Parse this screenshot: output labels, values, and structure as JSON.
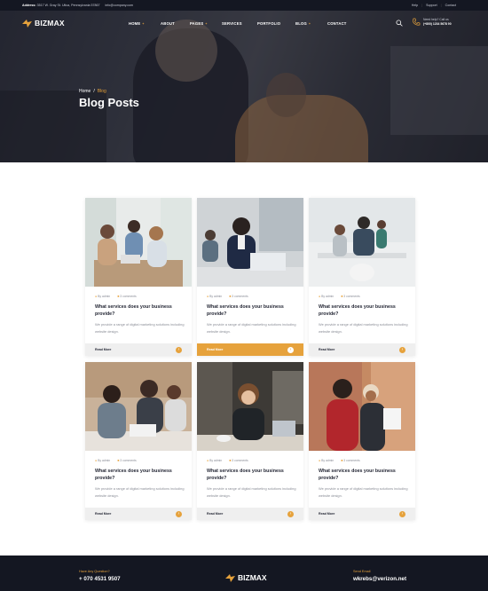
{
  "topbar": {
    "address_label": "Address:",
    "address_value": "3517 W. Gray St. Utica, Pennsylvania 57867",
    "email": "info@company.com",
    "links": [
      "Help",
      "Support",
      "Contact"
    ]
  },
  "brand": {
    "name": "BIZMAX",
    "accent": "#e6a23c",
    "dark": "#141722"
  },
  "nav": {
    "items": [
      {
        "label": "HOME",
        "has_caret": true,
        "caret": "+"
      },
      {
        "label": "ABOUT",
        "has_caret": false,
        "caret": ""
      },
      {
        "label": "PAGES",
        "has_caret": true,
        "caret": "+"
      },
      {
        "label": "SERVICES",
        "has_caret": false,
        "caret": ""
      },
      {
        "label": "PORTFOLIO",
        "has_caret": false,
        "caret": ""
      },
      {
        "label": "BLOG",
        "has_caret": true,
        "caret": "+"
      },
      {
        "label": "CONTACT",
        "has_caret": false,
        "caret": ""
      }
    ],
    "phone_label": "Need help? Call us",
    "phone_number": "(+800) 1234 5678 90"
  },
  "hero": {
    "breadcrumb_home": "Home",
    "breadcrumb_sep": "/",
    "breadcrumb_current": "Blog",
    "title": "Blog Posts"
  },
  "posts": [
    {
      "author": "By admin",
      "comments": "3 comments",
      "title": "What services does your business provide?",
      "excerpt": "We provide a range of digital marketing solutions including website design.",
      "more": "Read More",
      "active": false
    },
    {
      "author": "By admin",
      "comments": "3 comments",
      "title": "What services does your business provide?",
      "excerpt": "We provide a range of digital marketing solutions including website design.",
      "more": "Read More",
      "active": true
    },
    {
      "author": "By admin",
      "comments": "3 comments",
      "title": "What services does your business provide?",
      "excerpt": "We provide a range of digital marketing solutions including website design.",
      "more": "Read More",
      "active": false
    },
    {
      "author": "By admin",
      "comments": "3 comments",
      "title": "What services does your business provide?",
      "excerpt": "We provide a range of digital marketing solutions including website design.",
      "more": "Read More",
      "active": false
    },
    {
      "author": "By admin",
      "comments": "3 comments",
      "title": "What services does your business provide?",
      "excerpt": "We provide a range of digital marketing solutions including website design.",
      "more": "Read More",
      "active": false
    },
    {
      "author": "By admin",
      "comments": "3 comments",
      "title": "What services does your business provide?",
      "excerpt": "We provide a range of digital marketing solutions including website design.",
      "more": "Read More",
      "active": false
    }
  ],
  "footer": {
    "question_label": "Have Any Question?",
    "phone": "+ 070 4531 9507",
    "email_label": "Send Email",
    "email": "wkrebs@verizon.net"
  }
}
